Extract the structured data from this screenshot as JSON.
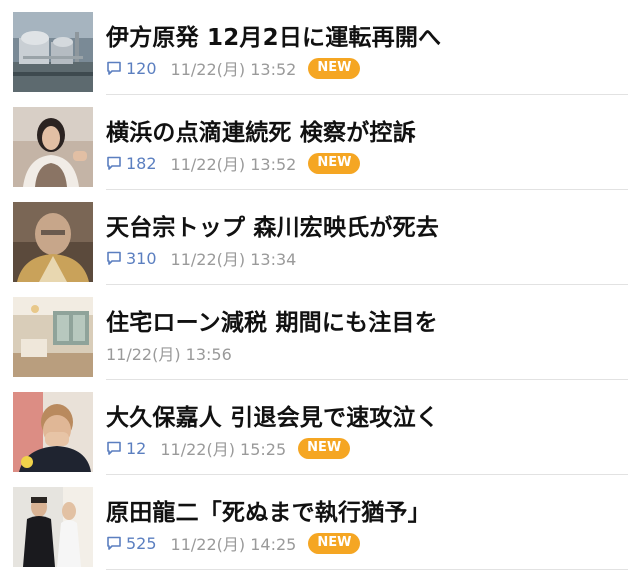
{
  "colors": {
    "comment_accent": "#5b7fc0",
    "timestamp": "#9a9a9a",
    "new_badge": "#f5a623",
    "headline": "#111111",
    "divider": "#e2e2e2"
  },
  "news": [
    {
      "headline": "伊方原発 12月2日に運転再開へ",
      "comments": "120",
      "timestamp": "11/22(月) 13:52",
      "badge": "NEW",
      "thumbnail_icon": "power-plant-photo"
    },
    {
      "headline": "横浜の点滴連続死 検察が控訴",
      "comments": "182",
      "timestamp": "11/22(月) 13:52",
      "badge": "NEW",
      "thumbnail_icon": "woman-portrait-photo"
    },
    {
      "headline": "天台宗トップ 森川宏映氏が死去",
      "comments": "310",
      "timestamp": "11/22(月) 13:34",
      "badge": "",
      "thumbnail_icon": "monk-portrait-photo"
    },
    {
      "headline": "住宅ローン減税 期間にも注目を",
      "comments": "",
      "timestamp": "11/22(月) 13:56",
      "badge": "",
      "thumbnail_icon": "living-room-photo"
    },
    {
      "headline": "大久保嘉人 引退会見で速攻泣く",
      "comments": "12",
      "timestamp": "11/22(月) 15:25",
      "badge": "NEW",
      "thumbnail_icon": "man-crying-photo"
    },
    {
      "headline": "原田龍二「死ぬまで執行猶予」",
      "comments": "525",
      "timestamp": "11/22(月) 14:25",
      "badge": "NEW",
      "thumbnail_icon": "couple-kimono-photo"
    }
  ]
}
